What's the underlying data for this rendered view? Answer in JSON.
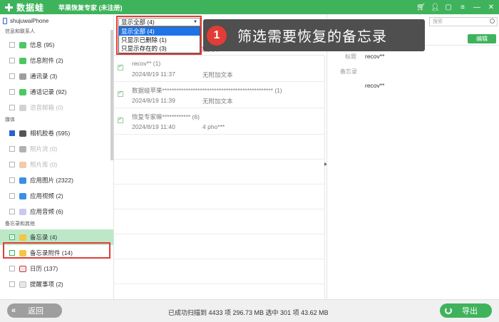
{
  "titlebar": {
    "logo_text": "数据蛙",
    "title": "苹果恢复专家 (未注册)"
  },
  "sidebar": {
    "device": "shujuwaiPhone",
    "sections": [
      {
        "label": "信息和联系人",
        "items": [
          {
            "label": "信息 (95)",
            "icon": "message-icon",
            "color": "#4cc764",
            "disabled": false
          },
          {
            "label": "信息附件 (2)",
            "icon": "attachment-icon",
            "color": "#4cc764",
            "disabled": false
          },
          {
            "label": "通讯录 (3)",
            "icon": "contacts-icon",
            "color": "#9e9e9e",
            "disabled": false
          },
          {
            "label": "通话记录 (92)",
            "icon": "phone-icon",
            "color": "#4cc764",
            "disabled": false
          },
          {
            "label": "语音邮箱 (0)",
            "icon": "voicemail-icon",
            "color": "#9e9e9e",
            "disabled": true
          }
        ]
      },
      {
        "label": "媒体",
        "items": [
          {
            "label": "相机胶卷 (595)",
            "icon": "camera-icon",
            "color": "#555555",
            "disabled": false
          },
          {
            "label": "照片流 (0)",
            "icon": "photostream-icon",
            "color": "#555555",
            "disabled": true
          },
          {
            "label": "照片库 (0)",
            "icon": "photolibrary-icon",
            "color": "#e88a3c",
            "disabled": true
          },
          {
            "label": "应用图片 (2322)",
            "icon": "app-image-icon",
            "color": "#3a8ee6",
            "disabled": false
          },
          {
            "label": "应用视频 (2)",
            "icon": "app-video-icon",
            "color": "#3a8ee6",
            "disabled": false
          },
          {
            "label": "应用音频 (6)",
            "icon": "app-audio-icon",
            "color": "#c9c9f0",
            "disabled": false
          }
        ]
      },
      {
        "label": "备忘录和其他",
        "items": [
          {
            "label": "备忘录 (4)",
            "icon": "notes-icon",
            "color": "#f5c543",
            "disabled": false,
            "selected": true
          },
          {
            "label": "备忘录附件 (14)",
            "icon": "notes-attachment-icon",
            "color": "#f5c543",
            "disabled": false
          },
          {
            "label": "日历 (137)",
            "icon": "calendar-icon",
            "color": "#e8e8e8",
            "disabled": false
          },
          {
            "label": "提醒事项 (2)",
            "icon": "reminders-icon",
            "color": "#e8e8e8",
            "disabled": false
          }
        ]
      }
    ]
  },
  "filter": {
    "selected": "显示全部 (4)",
    "options": [
      "显示全部 (4)",
      "只显示已删除 (1)",
      "只显示存在的 (3)"
    ],
    "tail_text": "加文本"
  },
  "callout": {
    "number": "1",
    "text": "筛选需要恢复的备忘录"
  },
  "list": {
    "rows": [
      {
        "title": "recov** (1)",
        "date": "2024/8/19 11:37",
        "desc": "无附加文本"
      },
      {
        "title": "数据蛙苹果*********************************************** (1)",
        "date": "2024/8/19 11:39",
        "desc": "无附加文本"
      },
      {
        "title": "恢复专家嘛************ (6)",
        "date": "2024/8/19 11:40",
        "desc": "4 pho***"
      }
    ]
  },
  "detail": {
    "search_placeholder": "搜索",
    "edit_label": "编辑",
    "title_label": "标题",
    "title_value": "recov**",
    "notes_label": "备忘录",
    "notes_value": "recov**"
  },
  "bottom": {
    "back_label": "返回",
    "status": "已成功扫描到 4433 项 296.73 MB  选中 301 项 43.62 MB",
    "export_label": "导出"
  }
}
